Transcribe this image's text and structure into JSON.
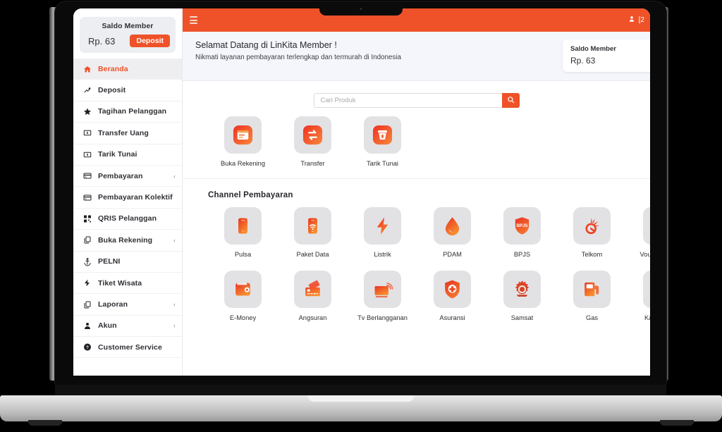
{
  "sidebar": {
    "balance": {
      "title": "Saldo Member",
      "amount": "Rp. 63",
      "deposit_label": "Deposit"
    },
    "items": [
      {
        "label": "Beranda",
        "icon": "home-icon",
        "active": true,
        "caret": ""
      },
      {
        "label": "Deposit",
        "icon": "deposit-icon",
        "active": false,
        "caret": ""
      },
      {
        "label": "Tagihan Pelanggan",
        "icon": "star-icon",
        "active": false,
        "caret": ""
      },
      {
        "label": "Transfer Uang",
        "icon": "money-icon",
        "active": false,
        "caret": ""
      },
      {
        "label": "Tarik Tunai",
        "icon": "cash-icon",
        "active": false,
        "caret": ""
      },
      {
        "label": "Pembayaran",
        "icon": "card-icon",
        "active": false,
        "caret": "‹"
      },
      {
        "label": "Pembayaran Kolektif",
        "icon": "card-icon",
        "active": false,
        "caret": ""
      },
      {
        "label": "QRIS Pelanggan",
        "icon": "qr-icon",
        "active": false,
        "caret": ""
      },
      {
        "label": "Buka Rekening",
        "icon": "copy-icon",
        "active": false,
        "caret": "‹"
      },
      {
        "label": "PELNI",
        "icon": "anchor-icon",
        "active": false,
        "caret": ""
      },
      {
        "label": "Tiket Wisata",
        "icon": "ticket-icon",
        "active": false,
        "caret": ""
      },
      {
        "label": "Laporan",
        "icon": "report-icon",
        "active": false,
        "caret": "‹"
      },
      {
        "label": "Akun",
        "icon": "user-icon",
        "active": false,
        "caret": "‹"
      },
      {
        "label": "Customer Service",
        "icon": "help-icon",
        "active": false,
        "caret": ""
      }
    ]
  },
  "topbar": {
    "menu_icon": "hamburger-icon",
    "user_icon": "user-icon",
    "username": "[2"
  },
  "welcome": {
    "title": "Selamat Datang di LinKita Member !",
    "subtitle": "Nikmati layanan pembayaran terlengkap dan termurah di Indonesia",
    "balance_title": "Saldo Member",
    "balance_amount": "Rp. 63"
  },
  "search": {
    "placeholder": "Cari Produk",
    "value": "",
    "button_icon": "search-icon"
  },
  "quick_actions": [
    {
      "label": "Buka Rekening",
      "icon": "open-account-icon"
    },
    {
      "label": "Transfer",
      "icon": "transfer-icon"
    },
    {
      "label": "Tarik Tunai",
      "icon": "withdraw-icon"
    }
  ],
  "channel_section": {
    "heading": "Channel Pembayaran",
    "row1": [
      {
        "label": "Pulsa",
        "icon": "phone-icon"
      },
      {
        "label": "Paket Data",
        "icon": "data-package-icon"
      },
      {
        "label": "Listrik",
        "icon": "bolt-icon"
      },
      {
        "label": "PDAM",
        "icon": "water-drop-icon"
      },
      {
        "label": "BPJS",
        "icon": "bpjs-shield-icon",
        "badge": "BPJS"
      },
      {
        "label": "Telkom",
        "icon": "telkom-icon"
      },
      {
        "label": "Voucher Game",
        "icon": "gamepad-icon"
      }
    ],
    "row2": [
      {
        "label": "E-Money",
        "icon": "wallet-icon"
      },
      {
        "label": "Angsuran",
        "icon": "credit-card-icon"
      },
      {
        "label": "Tv Berlangganan",
        "icon": "tv-icon"
      },
      {
        "label": "Asuransi",
        "icon": "insurance-shield-icon"
      },
      {
        "label": "Samsat",
        "icon": "samsat-emblem-icon"
      },
      {
        "label": "Gas",
        "icon": "gas-pump-icon"
      },
      {
        "label": "Kartu Kredit",
        "icon": "credit-card-red-icon"
      }
    ]
  },
  "colors": {
    "brand_orange": "#ef5229",
    "accent_orange": "#f6762f",
    "tile_bg": "#e2e2e5",
    "band_bg": "#f4f6fb",
    "sidebar_active_bg": "#eeeef1",
    "text_dark": "#26282c"
  }
}
